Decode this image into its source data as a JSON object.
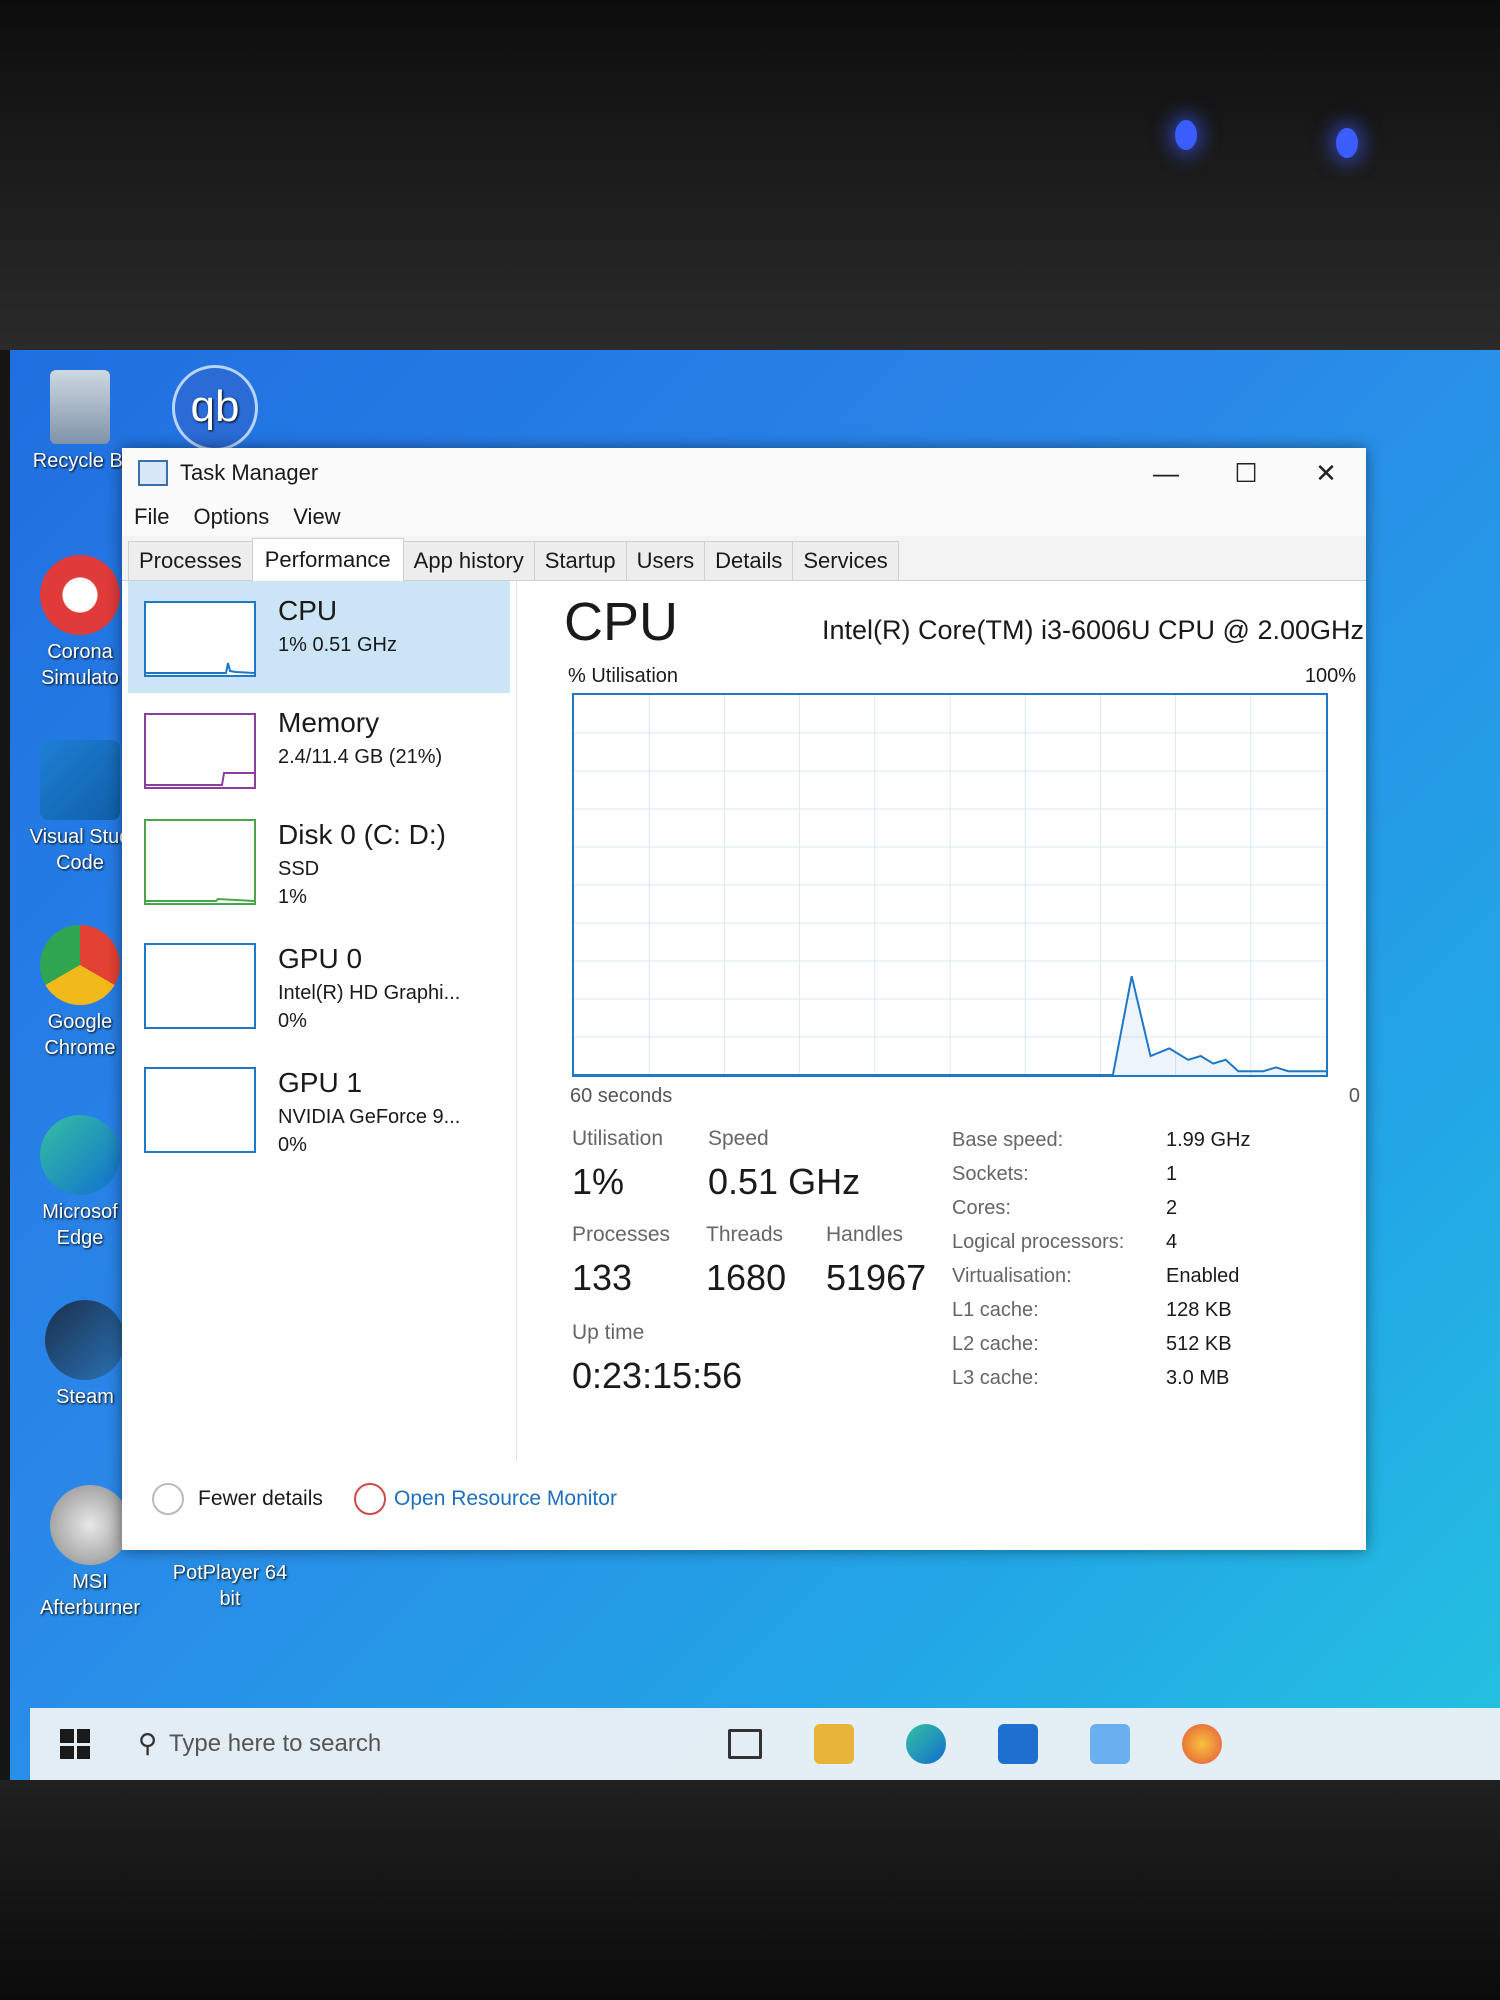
{
  "desktop": {
    "icons": [
      {
        "label": "Recycle Bi"
      },
      {
        "label": "Corona Simulato"
      },
      {
        "label": "Visual Stud Code"
      },
      {
        "label": "Google Chrome"
      },
      {
        "label": "Microsof Edge"
      },
      {
        "label": "Steam"
      },
      {
        "label": "MSI Afterburner"
      },
      {
        "label": "PotPlayer 64 bit"
      },
      {
        "label": "qb"
      }
    ]
  },
  "window": {
    "title": "Task Manager",
    "menu": [
      "File",
      "Options",
      "View"
    ],
    "tabs": [
      "Processes",
      "Performance",
      "App history",
      "Startup",
      "Users",
      "Details",
      "Services"
    ],
    "active_tab": "Performance"
  },
  "sidebar": {
    "items": [
      {
        "name": "CPU",
        "lines": [
          "1% 0.51 GHz"
        ]
      },
      {
        "name": "Memory",
        "lines": [
          "2.4/11.4 GB (21%)"
        ]
      },
      {
        "name": "Disk 0 (C: D:)",
        "lines": [
          "SSD",
          "1%"
        ]
      },
      {
        "name": "GPU 0",
        "lines": [
          "Intel(R) HD Graphi...",
          "0%"
        ]
      },
      {
        "name": "GPU 1",
        "lines": [
          "NVIDIA GeForce 9...",
          "0%"
        ]
      }
    ]
  },
  "cpu": {
    "title": "CPU",
    "model": "Intel(R) Core(TM) i3-6006U CPU @ 2.00GHz",
    "graph_label": "% Utilisation",
    "graph_max": "100%",
    "time_span": "60 seconds",
    "graph_min": "0",
    "utilisation_label": "Utilisation",
    "utilisation": "1%",
    "speed_label": "Speed",
    "speed": "0.51 GHz",
    "processes_label": "Processes",
    "processes": "133",
    "threads_label": "Threads",
    "threads": "1680",
    "handles_label": "Handles",
    "handles": "51967",
    "uptime_label": "Up time",
    "uptime": "0:23:15:56",
    "details": [
      {
        "key": "Base speed:",
        "value": "1.99 GHz"
      },
      {
        "key": "Sockets:",
        "value": "1"
      },
      {
        "key": "Cores:",
        "value": "2"
      },
      {
        "key": "Logical processors:",
        "value": "4"
      },
      {
        "key": "Virtualisation:",
        "value": "Enabled"
      },
      {
        "key": "L1 cache:",
        "value": "128 KB"
      },
      {
        "key": "L2 cache:",
        "value": "512 KB"
      },
      {
        "key": "L3 cache:",
        "value": "3.0 MB"
      }
    ]
  },
  "footer": {
    "fewer_details": "Fewer details",
    "open_resource_monitor": "Open Resource Monitor"
  },
  "taskbar": {
    "search_placeholder": "Type here to search"
  },
  "chart_data": {
    "type": "line",
    "title": "",
    "xlabel": "60 seconds",
    "ylabel": "% Utilisation",
    "xlim": [
      60,
      0
    ],
    "ylim": [
      0,
      100
    ],
    "grid": true,
    "series": [
      {
        "x": [
          60,
          17,
          15.5,
          14,
          12.5,
          11,
          10,
          9,
          8,
          7,
          6,
          5,
          4,
          3,
          2,
          1,
          0
        ],
        "values": [
          0,
          0,
          26,
          5,
          7,
          4,
          5,
          3,
          4,
          1,
          1,
          1,
          2,
          1,
          1,
          1,
          1
        ]
      }
    ],
    "color": "#1f78c6"
  }
}
